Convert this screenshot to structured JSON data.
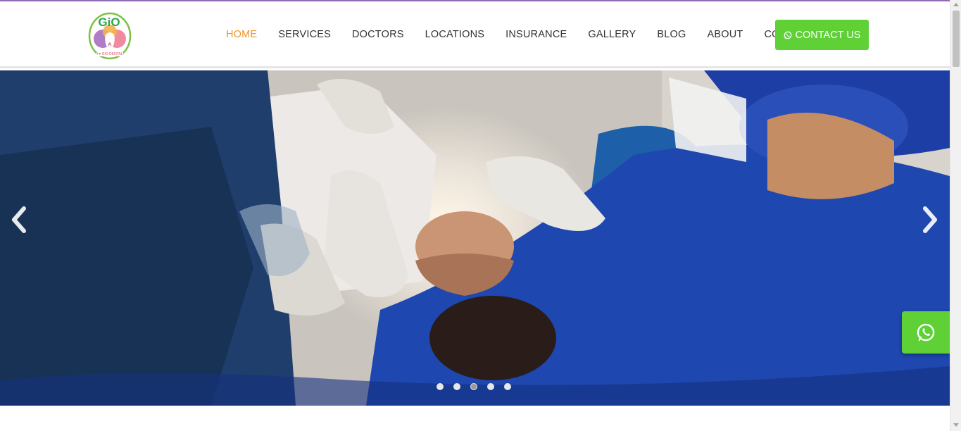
{
  "brand": {
    "logo_text": "GiO",
    "logo_subtext": "I ♥ GIO DENTAL",
    "colors": {
      "green": "#5fd137",
      "orange": "#f0932b",
      "purple": "#8e6bb0"
    }
  },
  "nav": {
    "items": [
      {
        "label": "HOME",
        "active": true
      },
      {
        "label": "SERVICES"
      },
      {
        "label": "DOCTORS"
      },
      {
        "label": "LOCATIONS"
      },
      {
        "label": "INSURANCE"
      },
      {
        "label": "GALLERY"
      },
      {
        "label": "BLOG"
      },
      {
        "label": "ABOUT"
      },
      {
        "label": "CONTACT"
      }
    ],
    "cta_label": "CONTACT US",
    "cta_icon": "whatsapp-icon"
  },
  "hero": {
    "slides_count": 5,
    "active_slide_index": 2,
    "prev_icon": "chevron-left-icon",
    "next_icon": "chevron-right-icon"
  },
  "floating": {
    "icon": "whatsapp-icon"
  }
}
